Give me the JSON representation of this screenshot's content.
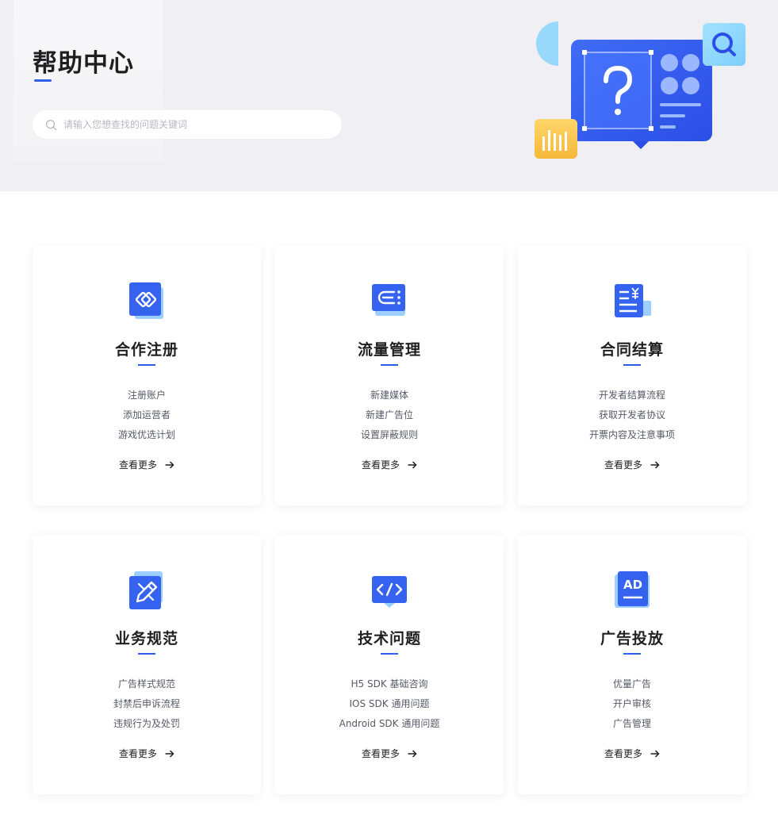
{
  "hero": {
    "title": "帮助中心",
    "search_placeholder": "请输入您想查找的问题关键词"
  },
  "accent_color": "#2f5fe8",
  "cards": [
    {
      "title": "合作注册",
      "icon": "link-icon",
      "links": [
        "注册账户",
        "添加运营者",
        "游戏优选计划"
      ],
      "more": "查看更多"
    },
    {
      "title": "流量管理",
      "icon": "traffic-icon",
      "links": [
        "新建媒体",
        "新建广告位",
        "设置屏蔽规则"
      ],
      "more": "查看更多"
    },
    {
      "title": "合同结算",
      "icon": "contract-icon",
      "links": [
        "开发者结算流程",
        "获取开发者协议",
        "开票内容及注意事项"
      ],
      "more": "查看更多"
    },
    {
      "title": "业务规范",
      "icon": "pencil-icon",
      "links": [
        "广告样式规范",
        "封禁后申诉流程",
        "违规行为及处罚"
      ],
      "more": "查看更多"
    },
    {
      "title": "技术问题",
      "icon": "code-icon",
      "links": [
        "H5 SDK 基础咨询",
        "IOS SDK 通用问题",
        "Android SDK 通用问题"
      ],
      "more": "查看更多"
    },
    {
      "title": "广告投放",
      "icon": "ad-icon",
      "ad_label": "AD",
      "links": [
        "优量广告",
        "开户审核",
        "广告管理"
      ],
      "more": "查看更多"
    }
  ]
}
